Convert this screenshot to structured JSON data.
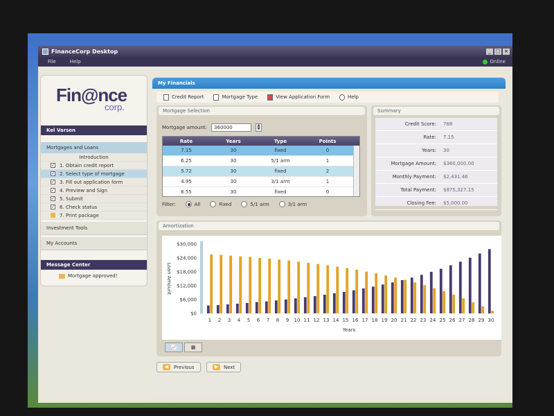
{
  "window": {
    "title": "FinanceCorp Desktop"
  },
  "menu": {
    "file": "File",
    "help": "Help"
  },
  "status": {
    "online": "Online"
  },
  "logo": {
    "line1": "Fin@nce",
    "line2": "corp."
  },
  "user": {
    "name": "Kel Varsen"
  },
  "sidebar": {
    "section_mortgages": "Mortgages and Loans",
    "intro": "Introduction",
    "steps": [
      {
        "label": "1. Obtain credit report",
        "checked": true
      },
      {
        "label": "2. Select type of mortgage",
        "checked": true
      },
      {
        "label": "3. Fill out application form",
        "checked": true
      },
      {
        "label": "4. Preview and Sign",
        "checked": true
      },
      {
        "label": "5. Submit",
        "checked": true
      },
      {
        "label": "6. Check status",
        "checked": true
      },
      {
        "label": "7. Print package",
        "checked": false
      }
    ],
    "investment_tools": "Investment Tools",
    "my_accounts": "My Accounts",
    "message_center": "Message Center",
    "message": "Mortgage approved!"
  },
  "main": {
    "header": "My Financials",
    "toolbar": {
      "credit_report": "Credit Report",
      "mortgage_type": "Mortgage Type",
      "view_application": "View Application Form",
      "help": "Help"
    }
  },
  "mortgage_selection": {
    "title": "Mortgage Selection",
    "amount_label": "Mortgage amount:",
    "amount_value": "360000",
    "columns": [
      "Rate",
      "Years",
      "Type",
      "Points"
    ],
    "rows": [
      [
        "7.15",
        "30",
        "fixed",
        "0"
      ],
      [
        "6.25",
        "30",
        "5/1 arm",
        "1"
      ],
      [
        "5.72",
        "30",
        "fixed",
        "2"
      ],
      [
        "4.95",
        "30",
        "3/1 arm",
        "1"
      ],
      [
        "6.55",
        "30",
        "fixed",
        "0"
      ]
    ],
    "filter_label": "Filter:",
    "filters": [
      "All",
      "Fixed",
      "5/1 arm",
      "3/1 arm"
    ]
  },
  "summary": {
    "title": "Summary",
    "rows": [
      {
        "label": "Credit Score:",
        "value": "768"
      },
      {
        "label": "Rate:",
        "value": "7.15"
      },
      {
        "label": "Years:",
        "value": "30"
      },
      {
        "label": "Mortgage Amount:",
        "value": "$360,000.00"
      },
      {
        "label": "Monthly Payment:",
        "value": "$2,431.46"
      },
      {
        "label": "Total Payment:",
        "value": "$875,327.15"
      },
      {
        "label": "Closing Fee:",
        "value": "$5,000.00"
      }
    ]
  },
  "amortization": {
    "title": "Amortization"
  },
  "nav": {
    "previous": "Previous",
    "next": "Next"
  },
  "colors": {
    "principal": "#4a3a6e",
    "interest": "#e3a225",
    "accent": "#3a8fd4"
  },
  "chart_data": {
    "type": "bar",
    "xlabel": "Years",
    "ylabel": "Loan Amount",
    "yticks": [
      "$0",
      "$6,000",
      "$12,000",
      "$18,000",
      "$24,000",
      "$30,000"
    ],
    "ylim": [
      0,
      30000
    ],
    "categories": [
      "1",
      "2",
      "3",
      "4",
      "5",
      "6",
      "7",
      "8",
      "9",
      "10",
      "11",
      "12",
      "13",
      "14",
      "15",
      "16",
      "17",
      "18",
      "19",
      "20",
      "21",
      "22",
      "23",
      "24",
      "25",
      "26",
      "27",
      "28",
      "29",
      "30"
    ],
    "series": [
      {
        "name": "Principal",
        "values": [
          3400,
          3600,
          3900,
          4200,
          4500,
          4900,
          5200,
          5600,
          6000,
          6500,
          7000,
          7500,
          8100,
          8700,
          9300,
          10000,
          10800,
          11600,
          12500,
          13400,
          14400,
          15500,
          16700,
          18000,
          19300,
          20800,
          22400,
          24100,
          25900,
          27800
        ]
      },
      {
        "name": "Interest",
        "values": [
          25500,
          25300,
          25000,
          24700,
          24400,
          24000,
          23700,
          23300,
          22900,
          22400,
          21900,
          21400,
          20800,
          20200,
          19600,
          18900,
          18100,
          17300,
          16400,
          15500,
          14500,
          13400,
          12200,
          10900,
          9600,
          8100,
          6500,
          4800,
          3000,
          1100
        ]
      }
    ],
    "legend": "none"
  }
}
